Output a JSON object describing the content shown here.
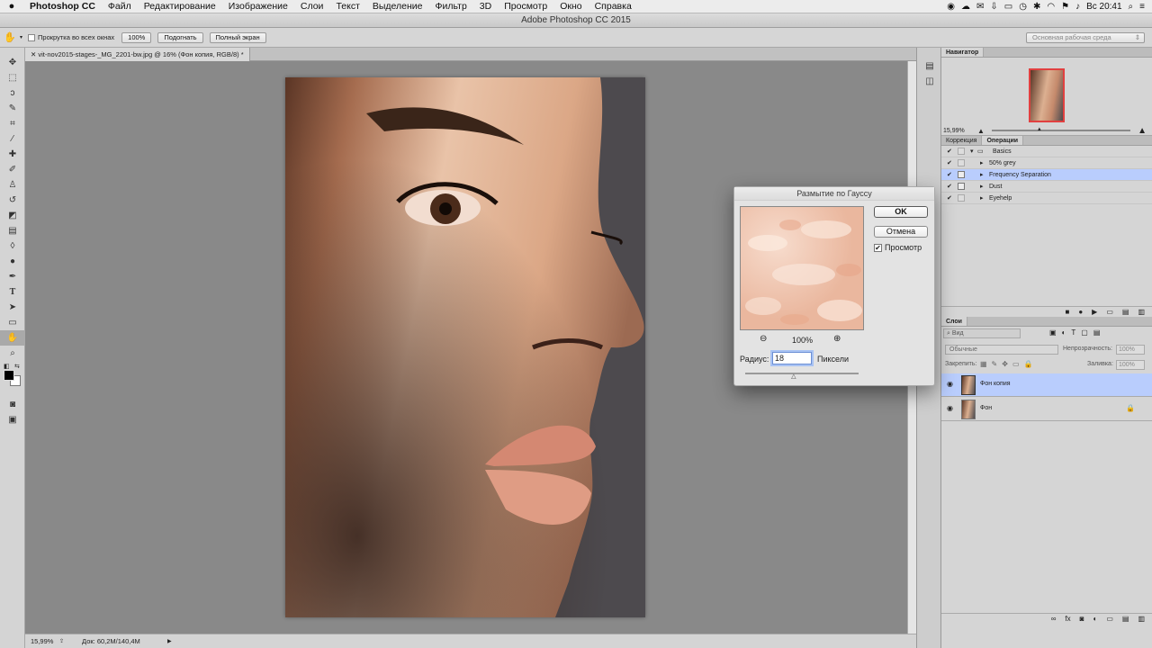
{
  "menubar": {
    "items": [
      "Photoshop CC",
      "Файл",
      "Редактирование",
      "Изображение",
      "Слои",
      "Текст",
      "Выделение",
      "Фильтр",
      "3D",
      "Просмотр",
      "Окно",
      "Справка"
    ],
    "clock": "Вс 20:41"
  },
  "window": {
    "title": "Adobe Photoshop CC 2015"
  },
  "options": {
    "scroll_all_label": "Прокрутка во всех окнах",
    "zoom_100": "100%",
    "fit_screen": "Подогнать",
    "full_screen": "Полный экран",
    "workspace": "Основная рабочая среда"
  },
  "document": {
    "tab_title": "vit-nov2015-stages-_MG_2201-bw.jpg @ 16% (Фон копия, RGB/8) *"
  },
  "status": {
    "zoom": "15,99%",
    "doc_info": "Док: 60,2M/140,4M"
  },
  "navigator": {
    "title": "Навигатор",
    "zoom": "15,99%"
  },
  "actions_panel": {
    "tabs": [
      "Коррекция",
      "Операции"
    ],
    "set_name": "Basics",
    "items": [
      "50% grey",
      "Frequency Separation",
      "Dust",
      "Eyehelp"
    ]
  },
  "layers_panel": {
    "title": "Слои",
    "filter_placeholder": "Вид",
    "blend_mode": "Обычные",
    "opacity_label": "Непрозрачность:",
    "opacity_value": "100%",
    "lock_label": "Закрепить:",
    "fill_label": "Заливка:",
    "fill_value": "100%",
    "layers": [
      "Фон копия",
      "Фон"
    ]
  },
  "dialog": {
    "title": "Размытие по Гауссу",
    "ok": "OK",
    "cancel": "Отмена",
    "preview_label": "Просмотр",
    "preview_checked": true,
    "zoom": "100%",
    "radius_label": "Радиус:",
    "radius_value": "18",
    "units": "Пиксели",
    "radius_slider_fraction": 0.43
  },
  "colors": {
    "selected_row": "#b9cdfd",
    "canvas_bg": "#898989",
    "panel_bg": "#d5d5d5"
  }
}
